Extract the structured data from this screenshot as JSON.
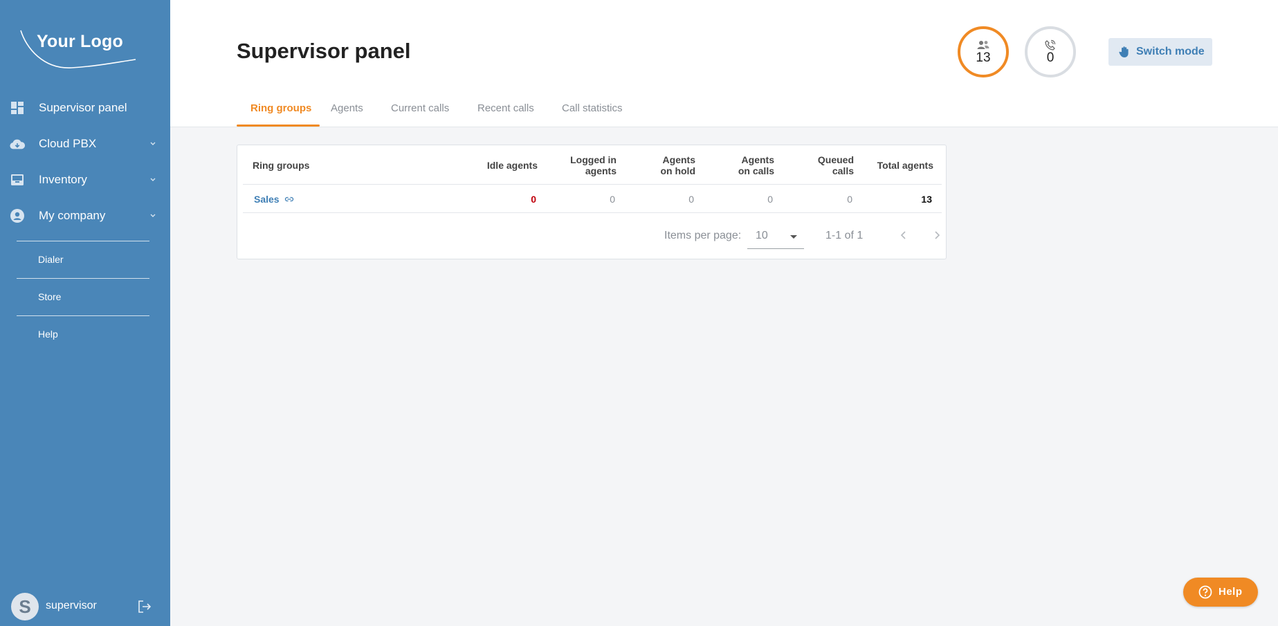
{
  "brand": {
    "logo_text": "Your Logo",
    "accent": "#f08a24",
    "sidebar_bg": "#4a86b8",
    "link": "#3f7fb5"
  },
  "sidebar": {
    "items": [
      {
        "label": "Supervisor panel",
        "icon": "dashboard-icon"
      },
      {
        "label": "Cloud PBX",
        "icon": "cloud-icon"
      },
      {
        "label": "Inventory",
        "icon": "inventory-icon"
      },
      {
        "label": "My company",
        "icon": "account-circle-icon"
      }
    ],
    "sub_items": [
      {
        "label": "Dialer"
      },
      {
        "label": "Store"
      },
      {
        "label": "Help"
      }
    ],
    "user": {
      "avatar_letter": "S",
      "name": "supervisor"
    }
  },
  "header": {
    "title": "Supervisor panel",
    "agents_count": "13",
    "calls_count": "0",
    "switch_mode_label": "Switch mode"
  },
  "tabs": [
    {
      "label": "Ring groups",
      "active": true
    },
    {
      "label": "Agents",
      "active": false
    },
    {
      "label": "Current calls",
      "active": false
    },
    {
      "label": "Recent calls",
      "active": false
    },
    {
      "label": "Call statistics",
      "active": false
    }
  ],
  "table": {
    "columns": [
      "Ring groups",
      "Idle agents",
      "Logged in agents",
      "Agents on hold",
      "Agents on calls",
      "Queued calls",
      "Total agents"
    ],
    "rows": [
      {
        "name": "Sales",
        "idle": "0",
        "logged_in": "0",
        "on_hold": "0",
        "on_calls": "0",
        "queued": "0",
        "total": "13"
      }
    ]
  },
  "paginator": {
    "items_per_page_label": "Items per page:",
    "page_size": "10",
    "range_label": "1-1 of 1"
  },
  "help_button": {
    "label": "Help"
  }
}
